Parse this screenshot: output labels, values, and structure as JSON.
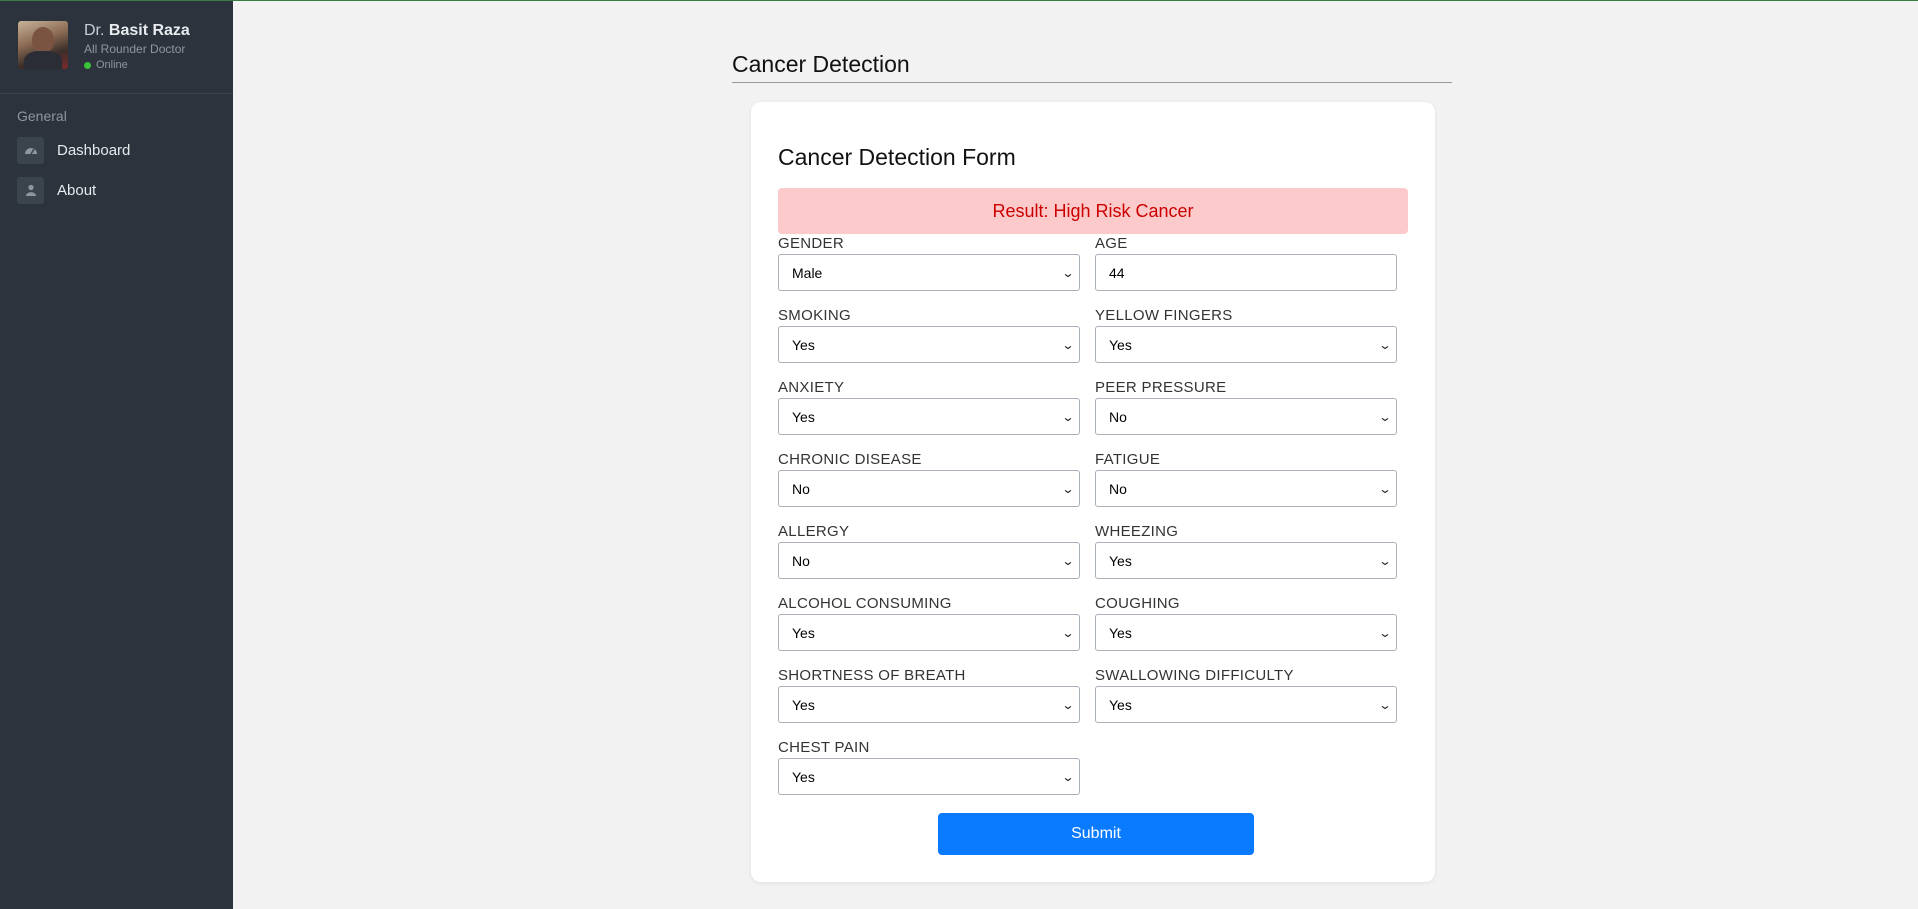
{
  "sidebar": {
    "profile": {
      "prefix": "Dr.",
      "name": "Basit Raza",
      "role": "All Rounder Doctor",
      "status": "Online"
    },
    "section_label": "General",
    "items": [
      {
        "label": "Dashboard",
        "icon": "dashboard-icon"
      },
      {
        "label": "About",
        "icon": "user-icon"
      }
    ]
  },
  "page": {
    "title": "Cancer Detection"
  },
  "form": {
    "title": "Cancer Detection Form",
    "result": "Result: High Risk Cancer",
    "fields": [
      {
        "label": "GENDER",
        "value": "Male",
        "type": "select"
      },
      {
        "label": "AGE",
        "value": "44",
        "type": "input"
      },
      {
        "label": "SMOKING",
        "value": "Yes",
        "type": "select"
      },
      {
        "label": "YELLOW FINGERS",
        "value": "Yes",
        "type": "select"
      },
      {
        "label": "ANXIETY",
        "value": "Yes",
        "type": "select"
      },
      {
        "label": "PEER PRESSURE",
        "value": "No",
        "type": "select"
      },
      {
        "label": "CHRONIC DISEASE",
        "value": "No",
        "type": "select"
      },
      {
        "label": "FATIGUE",
        "value": "No",
        "type": "select"
      },
      {
        "label": "ALLERGY",
        "value": "No",
        "type": "select"
      },
      {
        "label": "WHEEZING",
        "value": "Yes",
        "type": "select"
      },
      {
        "label": "ALCOHOL CONSUMING",
        "value": "Yes",
        "type": "select"
      },
      {
        "label": "COUGHING",
        "value": "Yes",
        "type": "select"
      },
      {
        "label": "SHORTNESS OF BREATH",
        "value": "Yes",
        "type": "select"
      },
      {
        "label": "SWALLOWING DIFFICULTY",
        "value": "Yes",
        "type": "select"
      },
      {
        "label": "CHEST PAIN",
        "value": "Yes",
        "type": "select"
      }
    ],
    "submit_label": "Submit"
  },
  "colors": {
    "sidebar_bg": "#2c333c",
    "alert_bg": "#fccaca",
    "alert_text": "#cc0000",
    "primary": "#0a7bff",
    "online": "#3cc13b"
  }
}
